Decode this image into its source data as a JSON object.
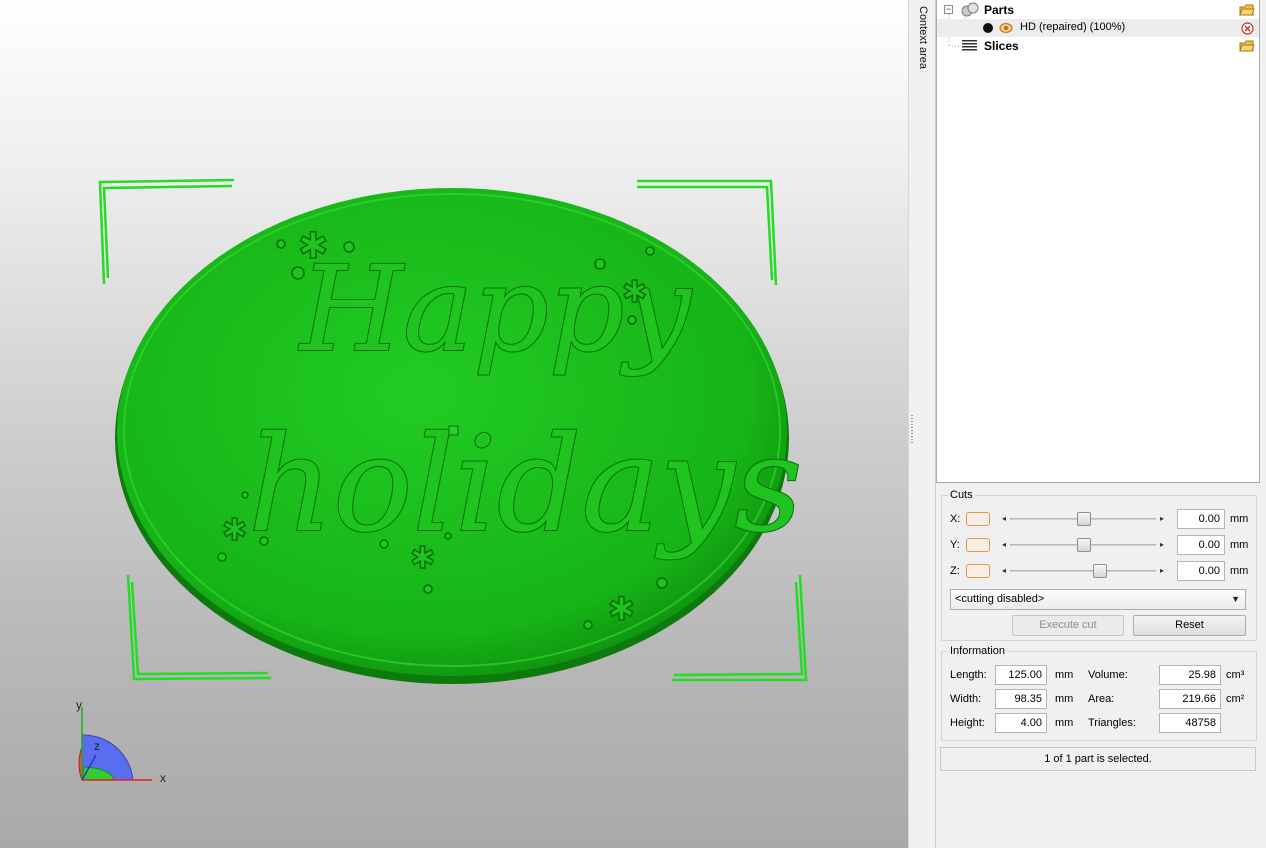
{
  "viewport": {
    "model_text_line1": "Happy",
    "model_text_line2": "holidays",
    "axis_x": "x",
    "axis_y": "y",
    "axis_z": "z",
    "model_color": "#1fc41f",
    "selection_color": "#22dd22"
  },
  "context_tab": {
    "label": "Context area"
  },
  "tree": {
    "parts_label": "Parts",
    "part_item_label": "HD (repaired) (100%)",
    "slices_label": "Slices",
    "expander_symbol": "−"
  },
  "cuts": {
    "legend": "Cuts",
    "axes": [
      {
        "label": "X:",
        "value": "0.00",
        "unit": "mm",
        "position": 0.48
      },
      {
        "label": "Y:",
        "value": "0.00",
        "unit": "mm",
        "position": 0.48
      },
      {
        "label": "Z:",
        "value": "0.00",
        "unit": "mm",
        "position": 0.58
      }
    ],
    "mode_select": "<cutting disabled>",
    "execute_label": "Execute cut",
    "reset_label": "Reset"
  },
  "information": {
    "legend": "Information",
    "length_label": "Length:",
    "length_value": "125.00",
    "length_unit": "mm",
    "width_label": "Width:",
    "width_value": "98.35",
    "width_unit": "mm",
    "height_label": "Height:",
    "height_value": "4.00",
    "height_unit": "mm",
    "volume_label": "Volume:",
    "volume_value": "25.98",
    "volume_unit": "cm³",
    "area_label": "Area:",
    "area_value": "219.66",
    "area_unit": "cm²",
    "triangles_label": "Triangles:",
    "triangles_value": "48758"
  },
  "status": {
    "text": "1 of 1 part is selected."
  }
}
